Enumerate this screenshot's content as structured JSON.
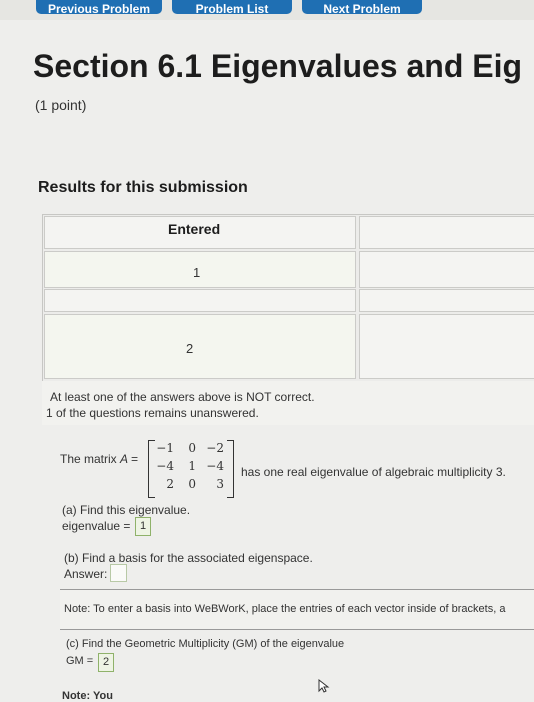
{
  "nav": {
    "prev_problem": "Previous Problem",
    "problem_list": "Problem List",
    "next_problem": "Next Problem"
  },
  "header": {
    "title": "Section 6.1 Eigenvalues and Eig",
    "points": "(1 point)"
  },
  "results": {
    "title": "Results for this submission",
    "column_header": "Entered",
    "entered_values": [
      "1",
      "2"
    ],
    "message_line1": "At least one of the answers above is NOT correct.",
    "message_line2": "1 of the questions remains unanswered."
  },
  "problem": {
    "matrix_prefix": "The matrix",
    "matrix_var": "A =",
    "matrix": [
      [
        "−1",
        "0",
        "−2"
      ],
      [
        "−4",
        "1",
        "−4"
      ],
      [
        "2",
        "0",
        "3"
      ]
    ],
    "matrix_suffix": "has one real eigenvalue of algebraic multiplicity 3.",
    "part_a": "(a) Find this eigenvalue.",
    "eigenvalue_label": "eigenvalue =",
    "eigenvalue_value": "1",
    "part_b": "(b) Find a basis for the associated eigenspace.",
    "answer_label": "Answer:",
    "note": "Note: To enter a basis into WeBWorK, place the entries of each vector inside of brackets, a",
    "part_c": "(c) Find the Geometric Multiplicity (GM) of the eigenvalue",
    "gm_label": "GM =",
    "gm_value": "2",
    "note2": "Note: You"
  },
  "colors": {
    "nav_button": "#1f6fb3",
    "answer_border": "#8fb26a",
    "background": "#eeeeec"
  }
}
